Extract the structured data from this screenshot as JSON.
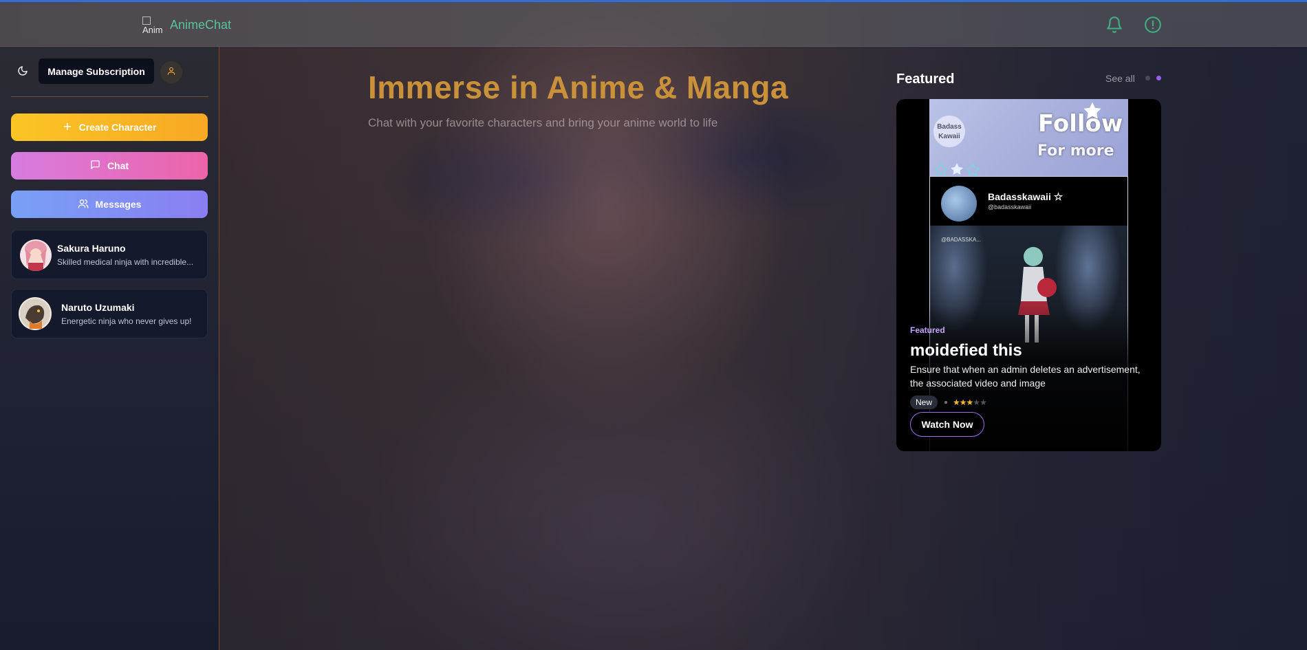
{
  "header": {
    "logo_alt": "Anim",
    "app_title": "AnimeChat",
    "icons": [
      "bell-icon",
      "info-icon"
    ]
  },
  "sidebar": {
    "theme_icon": "moon-icon",
    "manage_subscription": "Manage Subscription",
    "user_icon": "user-icon",
    "actions": [
      {
        "label": "Create Character",
        "icon": "plus-icon"
      },
      {
        "label": "Chat",
        "icon": "message-square-icon"
      },
      {
        "label": "Messages",
        "icon": "users-icon"
      }
    ],
    "characters": [
      {
        "name": "Sakura Haruno",
        "desc": "Skilled medical ninja with incredible..."
      },
      {
        "name": "Naruto Uzumaki",
        "desc": "Energetic ninja who never gives up!"
      }
    ]
  },
  "hero": {
    "title": "Immerse in Anime & Manga",
    "subtitle": "Chat with your favorite characters and bring your anime world to life"
  },
  "featured": {
    "heading": "Featured",
    "see_all": "See all",
    "banner": {
      "tag_line1": "Badass",
      "tag_line2": "Kawaii",
      "follow": "Follow",
      "for_more": "For more",
      "profile_name": "Badasskawaii",
      "profile_handle": "@badasskawaii",
      "scene_tag": "@BADASSKA..."
    },
    "label": "Featured",
    "name": "moidefied this",
    "description": "Ensure that when an admin deletes an advertisement, the associated video and image",
    "badge": "New",
    "rating": 3,
    "rating_max": 5,
    "watch_button": "Watch Now"
  },
  "colors": {
    "accent_top_line": "#2f6fd6",
    "app_title": "#58c39a",
    "hero_title": "#c9913a",
    "create_btn": "#fbc525",
    "chat_btn": "#ec64a8",
    "messages_btn": "#8a7ef2",
    "featured_label": "#c7a6ff",
    "star_filled": "#f5b82e"
  }
}
